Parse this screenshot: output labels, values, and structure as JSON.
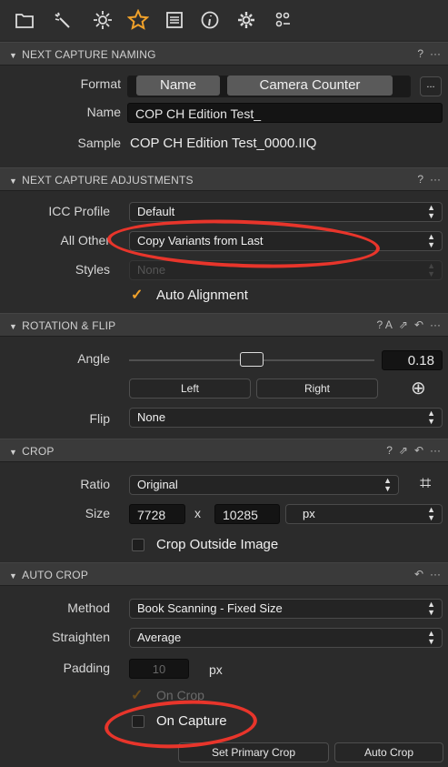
{
  "toolbar": {
    "icons": [
      "folder-icon",
      "wand-icon",
      "sun-icon",
      "star-icon",
      "list-icon",
      "info-icon",
      "gear-icon",
      "sliders-icon"
    ]
  },
  "colors": {
    "accent": "#f0a12a",
    "annotation": "#e8352b"
  },
  "next_capture_naming": {
    "title": "NEXT CAPTURE NAMING",
    "help": "?",
    "more": "···",
    "format_label": "Format",
    "format_tokens": [
      "Name",
      "Camera Counter"
    ],
    "format_more": "...",
    "name_label": "Name",
    "name_value": "COP CH Edition Test_",
    "sample_label": "Sample",
    "sample_value": "COP CH Edition Test_0000.IIQ"
  },
  "next_capture_adjustments": {
    "title": "NEXT CAPTURE ADJUSTMENTS",
    "help": "?",
    "more": "···",
    "icc_label": "ICC Profile",
    "icc_value": "Default",
    "all_other_label": "All Other",
    "all_other_value": "Copy Variants from Last",
    "styles_label": "Styles",
    "styles_value": "None",
    "auto_alignment_label": "Auto Alignment",
    "auto_alignment_checked": true
  },
  "rotation_flip": {
    "title": "ROTATION & FLIP",
    "right_icons": "? A",
    "more": "···",
    "angle_label": "Angle",
    "angle_value": "0.18",
    "angle_slider_fraction": 0.5,
    "left_button": "Left",
    "right_button": "Right",
    "flip_label": "Flip",
    "flip_value": "None"
  },
  "crop": {
    "title": "CROP",
    "help": "?",
    "more": "···",
    "ratio_label": "Ratio",
    "ratio_value": "Original",
    "size_label": "Size",
    "width_value": "7728",
    "times": "x",
    "height_value": "10285",
    "unit_value": "px",
    "crop_outside_label": "Crop Outside Image",
    "crop_outside_checked": false
  },
  "auto_crop": {
    "title": "AUTO CROP",
    "more": "···",
    "method_label": "Method",
    "method_value": "Book Scanning - Fixed Size",
    "straighten_label": "Straighten",
    "straighten_value": "Average",
    "padding_label": "Padding",
    "padding_value": "10",
    "padding_unit": "px",
    "on_crop_label": "On Crop",
    "on_capture_label": "On Capture",
    "on_capture_checked": false,
    "set_primary_crop": "Set Primary Crop",
    "auto_crop_button": "Auto Crop"
  }
}
